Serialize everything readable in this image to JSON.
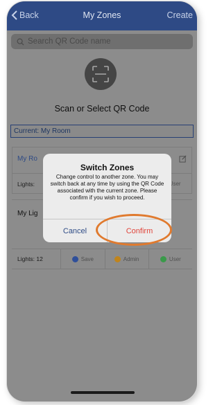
{
  "header": {
    "back_label": "Back",
    "title": "My Zones",
    "create_label": "Create"
  },
  "search": {
    "placeholder": "Search QR Code name"
  },
  "scan": {
    "label": "Scan or Select QR Code"
  },
  "current_zone": {
    "label": "Current: My Room"
  },
  "zones": [
    {
      "name": "My Ro",
      "lights_label": "Lights:",
      "actions": [
        {
          "label": "User",
          "color": "#3a9a4a"
        }
      ]
    },
    {
      "name": "My Lig",
      "lights_label": "Lights: 12",
      "actions": [
        {
          "label": "Save",
          "color": "#2f4f9a"
        },
        {
          "label": "Admin",
          "color": "#c0841c"
        },
        {
          "label": "User",
          "color": "#3a9a4a"
        }
      ]
    }
  ],
  "modal": {
    "title": "Switch Zones",
    "message": "Change control to another zone. You may switch back at any time by using the QR Code associated with the current zone. Please confirm if you wish to proceed.",
    "cancel_label": "Cancel",
    "confirm_label": "Confirm"
  },
  "colors": {
    "header": "#2e4a85",
    "confirm": "#e0443a",
    "highlight": "#e07a2e"
  }
}
